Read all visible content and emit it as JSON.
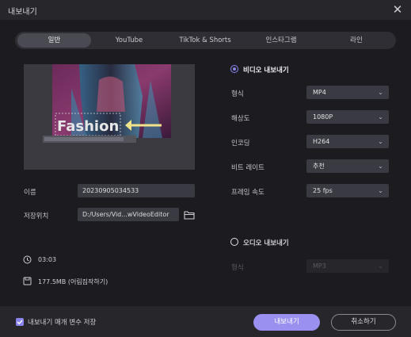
{
  "window": {
    "title": "내보내기"
  },
  "tabs": [
    {
      "label": "일반",
      "active": true
    },
    {
      "label": "YouTube",
      "active": false
    },
    {
      "label": "TikTok & Shorts",
      "active": false
    },
    {
      "label": "인스타그램",
      "active": false
    },
    {
      "label": "라인",
      "active": false
    }
  ],
  "preview": {
    "overlay_text": "Fashion"
  },
  "name_field": {
    "label": "이름",
    "value": "20230905034533"
  },
  "save_field": {
    "label": "저장위치",
    "value": "D:/Users/Vid...wVideoEditor"
  },
  "meta": {
    "duration": "03:03",
    "size": "177.5MB (어림짐작하기)"
  },
  "video_export": {
    "title": "비디오 내보내기",
    "selected": true,
    "settings": [
      {
        "label": "형식",
        "value": "MP4"
      },
      {
        "label": "해상도",
        "value": "1080P"
      },
      {
        "label": "인코딩",
        "value": "H264"
      },
      {
        "label": "비트 레이트",
        "value": "추천"
      },
      {
        "label": "프레임 속도",
        "value": "25  fps"
      }
    ]
  },
  "audio_export": {
    "title": "오디오 내보내기",
    "selected": false,
    "format_label": "형식",
    "format_value": "MP3"
  },
  "footer": {
    "checkbox_label": "내보내기 매개 변수 저장",
    "checkbox_checked": true,
    "export_button": "내보내기",
    "cancel_button": "취소하기"
  },
  "colors": {
    "accent": "#9a90f0",
    "background": "#1c1c20"
  }
}
